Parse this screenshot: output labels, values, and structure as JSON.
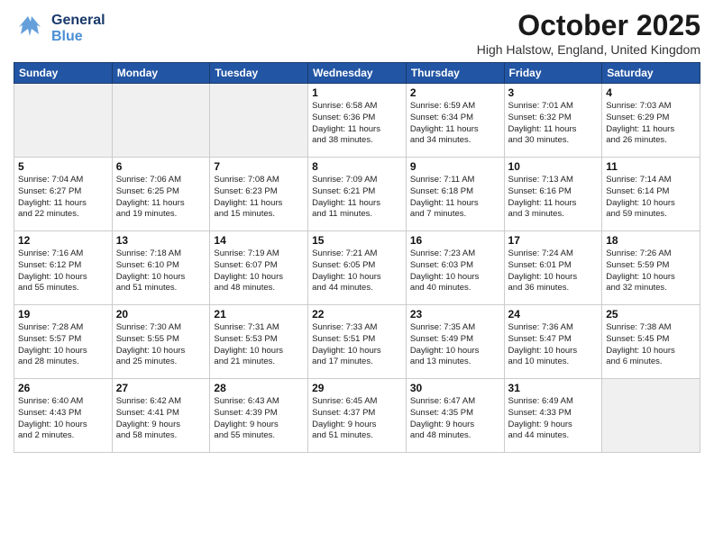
{
  "header": {
    "logo_general": "General",
    "logo_blue": "Blue",
    "month": "October 2025",
    "location": "High Halstow, England, United Kingdom"
  },
  "weekdays": [
    "Sunday",
    "Monday",
    "Tuesday",
    "Wednesday",
    "Thursday",
    "Friday",
    "Saturday"
  ],
  "weeks": [
    [
      {
        "day": "",
        "info": ""
      },
      {
        "day": "",
        "info": ""
      },
      {
        "day": "",
        "info": ""
      },
      {
        "day": "1",
        "info": "Sunrise: 6:58 AM\nSunset: 6:36 PM\nDaylight: 11 hours\nand 38 minutes."
      },
      {
        "day": "2",
        "info": "Sunrise: 6:59 AM\nSunset: 6:34 PM\nDaylight: 11 hours\nand 34 minutes."
      },
      {
        "day": "3",
        "info": "Sunrise: 7:01 AM\nSunset: 6:32 PM\nDaylight: 11 hours\nand 30 minutes."
      },
      {
        "day": "4",
        "info": "Sunrise: 7:03 AM\nSunset: 6:29 PM\nDaylight: 11 hours\nand 26 minutes."
      }
    ],
    [
      {
        "day": "5",
        "info": "Sunrise: 7:04 AM\nSunset: 6:27 PM\nDaylight: 11 hours\nand 22 minutes."
      },
      {
        "day": "6",
        "info": "Sunrise: 7:06 AM\nSunset: 6:25 PM\nDaylight: 11 hours\nand 19 minutes."
      },
      {
        "day": "7",
        "info": "Sunrise: 7:08 AM\nSunset: 6:23 PM\nDaylight: 11 hours\nand 15 minutes."
      },
      {
        "day": "8",
        "info": "Sunrise: 7:09 AM\nSunset: 6:21 PM\nDaylight: 11 hours\nand 11 minutes."
      },
      {
        "day": "9",
        "info": "Sunrise: 7:11 AM\nSunset: 6:18 PM\nDaylight: 11 hours\nand 7 minutes."
      },
      {
        "day": "10",
        "info": "Sunrise: 7:13 AM\nSunset: 6:16 PM\nDaylight: 11 hours\nand 3 minutes."
      },
      {
        "day": "11",
        "info": "Sunrise: 7:14 AM\nSunset: 6:14 PM\nDaylight: 10 hours\nand 59 minutes."
      }
    ],
    [
      {
        "day": "12",
        "info": "Sunrise: 7:16 AM\nSunset: 6:12 PM\nDaylight: 10 hours\nand 55 minutes."
      },
      {
        "day": "13",
        "info": "Sunrise: 7:18 AM\nSunset: 6:10 PM\nDaylight: 10 hours\nand 51 minutes."
      },
      {
        "day": "14",
        "info": "Sunrise: 7:19 AM\nSunset: 6:07 PM\nDaylight: 10 hours\nand 48 minutes."
      },
      {
        "day": "15",
        "info": "Sunrise: 7:21 AM\nSunset: 6:05 PM\nDaylight: 10 hours\nand 44 minutes."
      },
      {
        "day": "16",
        "info": "Sunrise: 7:23 AM\nSunset: 6:03 PM\nDaylight: 10 hours\nand 40 minutes."
      },
      {
        "day": "17",
        "info": "Sunrise: 7:24 AM\nSunset: 6:01 PM\nDaylight: 10 hours\nand 36 minutes."
      },
      {
        "day": "18",
        "info": "Sunrise: 7:26 AM\nSunset: 5:59 PM\nDaylight: 10 hours\nand 32 minutes."
      }
    ],
    [
      {
        "day": "19",
        "info": "Sunrise: 7:28 AM\nSunset: 5:57 PM\nDaylight: 10 hours\nand 28 minutes."
      },
      {
        "day": "20",
        "info": "Sunrise: 7:30 AM\nSunset: 5:55 PM\nDaylight: 10 hours\nand 25 minutes."
      },
      {
        "day": "21",
        "info": "Sunrise: 7:31 AM\nSunset: 5:53 PM\nDaylight: 10 hours\nand 21 minutes."
      },
      {
        "day": "22",
        "info": "Sunrise: 7:33 AM\nSunset: 5:51 PM\nDaylight: 10 hours\nand 17 minutes."
      },
      {
        "day": "23",
        "info": "Sunrise: 7:35 AM\nSunset: 5:49 PM\nDaylight: 10 hours\nand 13 minutes."
      },
      {
        "day": "24",
        "info": "Sunrise: 7:36 AM\nSunset: 5:47 PM\nDaylight: 10 hours\nand 10 minutes."
      },
      {
        "day": "25",
        "info": "Sunrise: 7:38 AM\nSunset: 5:45 PM\nDaylight: 10 hours\nand 6 minutes."
      }
    ],
    [
      {
        "day": "26",
        "info": "Sunrise: 6:40 AM\nSunset: 4:43 PM\nDaylight: 10 hours\nand 2 minutes."
      },
      {
        "day": "27",
        "info": "Sunrise: 6:42 AM\nSunset: 4:41 PM\nDaylight: 9 hours\nand 58 minutes."
      },
      {
        "day": "28",
        "info": "Sunrise: 6:43 AM\nSunset: 4:39 PM\nDaylight: 9 hours\nand 55 minutes."
      },
      {
        "day": "29",
        "info": "Sunrise: 6:45 AM\nSunset: 4:37 PM\nDaylight: 9 hours\nand 51 minutes."
      },
      {
        "day": "30",
        "info": "Sunrise: 6:47 AM\nSunset: 4:35 PM\nDaylight: 9 hours\nand 48 minutes."
      },
      {
        "day": "31",
        "info": "Sunrise: 6:49 AM\nSunset: 4:33 PM\nDaylight: 9 hours\nand 44 minutes."
      },
      {
        "day": "",
        "info": ""
      }
    ]
  ]
}
